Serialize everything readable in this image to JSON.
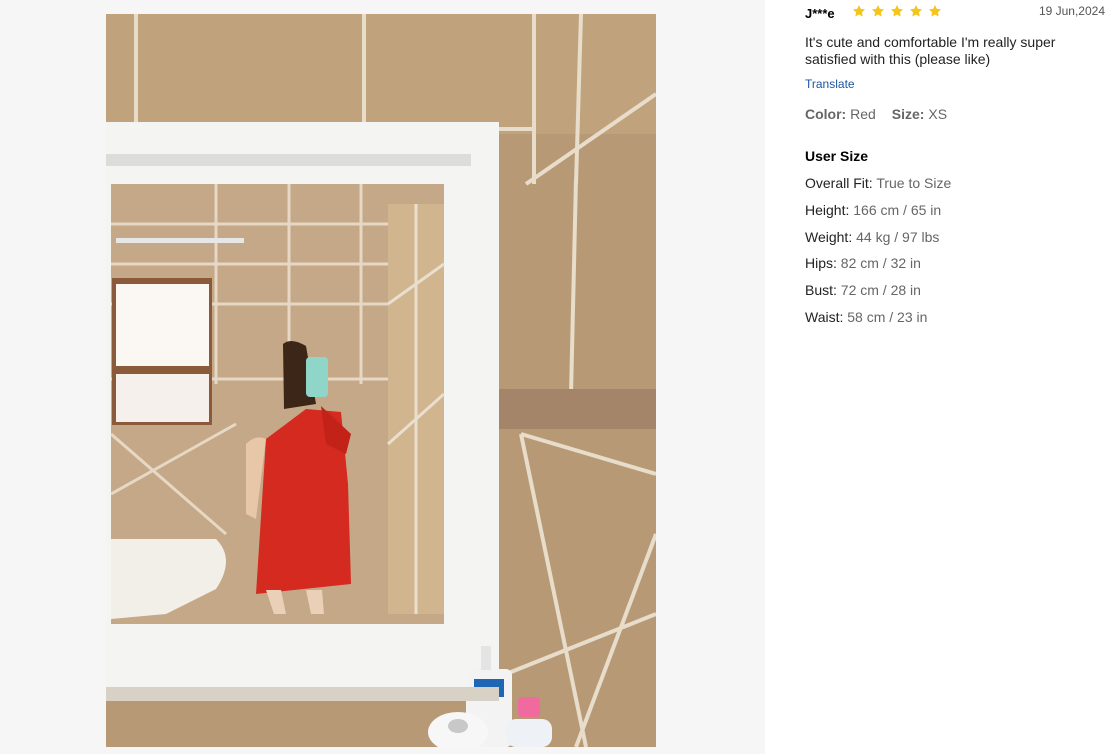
{
  "photo": {
    "alt_subject": "mirror-selfie"
  },
  "review": {
    "reviewer": "J***e",
    "rating": 5,
    "rating_max": 5,
    "date": "19 Jun,2024",
    "text": "It's cute and comfortable I'm really super satisfied with this (please like)",
    "translate_label": "Translate",
    "color_label": "Color:",
    "color_value": "Red",
    "size_label": "Size:",
    "size_value": "XS",
    "star_color": "#f5c518"
  },
  "user_size": {
    "title": "User Size",
    "items": [
      {
        "label": "Overall Fit:",
        "value": "True to Size"
      },
      {
        "label": "Height:",
        "value": "166 cm / 65 in"
      },
      {
        "label": "Weight:",
        "value": "44 kg / 97 lbs"
      },
      {
        "label": "Hips:",
        "value": "82 cm / 32 in"
      },
      {
        "label": "Bust:",
        "value": "72 cm / 28 in"
      },
      {
        "label": "Waist:",
        "value": "58 cm / 23 in"
      }
    ]
  }
}
